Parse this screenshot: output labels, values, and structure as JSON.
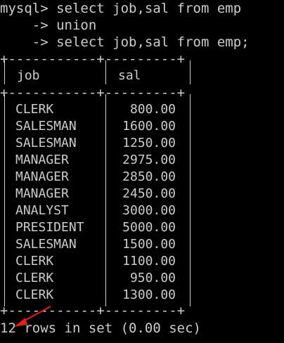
{
  "terminal": {
    "background": "#000000",
    "foreground": "#cccccc",
    "accent_arrow": "#e0201c",
    "command_lines": [
      "mysql> select job,sal from emp",
      "    -> union",
      "    -> select job,sal from emp;"
    ],
    "border_line": "+-----------+---------+",
    "header": {
      "job": "job",
      "sal": "sal"
    },
    "rows": [
      {
        "job": "CLERK",
        "sal": "800.00"
      },
      {
        "job": "SALESMAN",
        "sal": "1600.00"
      },
      {
        "job": "SALESMAN",
        "sal": "1250.00"
      },
      {
        "job": "MANAGER",
        "sal": "2975.00"
      },
      {
        "job": "MANAGER",
        "sal": "2850.00"
      },
      {
        "job": "MANAGER",
        "sal": "2450.00"
      },
      {
        "job": "ANALYST",
        "sal": "3000.00"
      },
      {
        "job": "PRESIDENT",
        "sal": "5000.00"
      },
      {
        "job": "SALESMAN",
        "sal": "1500.00"
      },
      {
        "job": "CLERK",
        "sal": "1100.00"
      },
      {
        "job": "CLERK",
        "sal": "950.00"
      },
      {
        "job": "CLERK",
        "sal": "1300.00"
      }
    ],
    "footer": "12 rows in set (0.00 sec)",
    "annotation_icon": "red-arrow-icon"
  }
}
